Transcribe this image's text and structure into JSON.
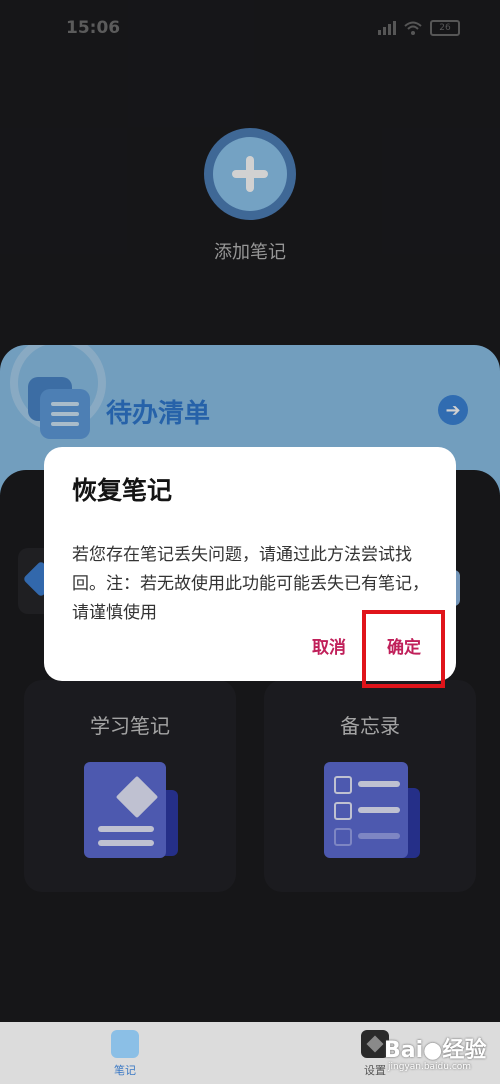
{
  "status_bar": {
    "time": "15:06",
    "battery": "26"
  },
  "add_note": {
    "label": "添加笔记"
  },
  "todo_card": {
    "title": "待办清单"
  },
  "cards": [
    {
      "title": "学习笔记"
    },
    {
      "title": "备忘录"
    }
  ],
  "dialog": {
    "title": "恢复笔记",
    "body": "若您存在笔记丢失问题，请通过此方法尝试找回。注：若无故使用此功能可能丢失已有笔记，请谨慎使用",
    "cancel_label": "取消",
    "ok_label": "确定"
  },
  "bottom_nav": [
    {
      "label": "笔记"
    },
    {
      "label": "设置"
    }
  ],
  "watermark": {
    "text": "Bai●经验",
    "sub": "jingyan.baidu.com"
  },
  "colors": {
    "accent": "#c0205a",
    "highlight": "#e0141a",
    "todo": "#8bc1e8"
  }
}
